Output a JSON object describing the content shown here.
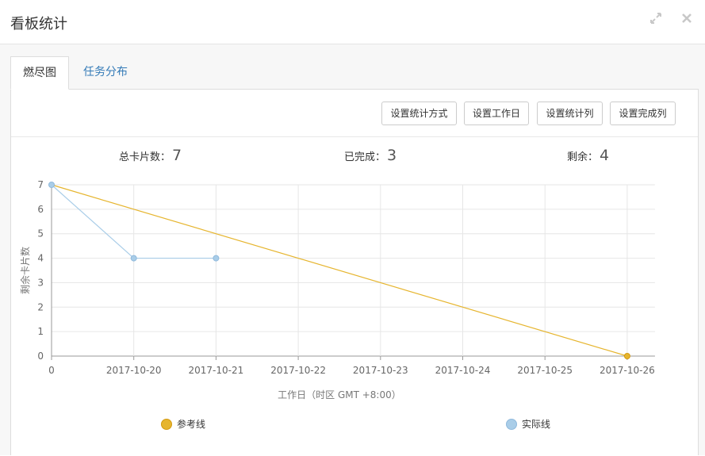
{
  "modal": {
    "title": "看板统计",
    "expand_icon": "expand-icon",
    "close_icon": "close-icon"
  },
  "tabs": [
    {
      "label": "燃尽图",
      "active": true
    },
    {
      "label": "任务分布",
      "active": false
    }
  ],
  "toolbar": {
    "buttons": [
      "设置统计方式",
      "设置工作日",
      "设置统计列",
      "设置完成列"
    ]
  },
  "stats": {
    "total_label": "总卡片数：",
    "total_value": "7",
    "done_label": "已完成：",
    "done_value": "3",
    "remain_label": "剩余：",
    "remain_value": "4"
  },
  "chart_data": {
    "type": "line",
    "x_categories": [
      "0",
      "2017-10-20",
      "2017-10-21",
      "2017-10-22",
      "2017-10-23",
      "2017-10-24",
      "2017-10-25",
      "2017-10-26"
    ],
    "ylim": [
      0,
      7
    ],
    "yticks": [
      0,
      1,
      2,
      3,
      4,
      5,
      6,
      7
    ],
    "xlabel": "工作日（时区 GMT +8:00）",
    "ylabel": "剩余卡片数",
    "grid": true,
    "legend_position": "bottom",
    "series": [
      {
        "name": "参考线",
        "color": "#e6b52e",
        "points": [
          [
            0,
            7
          ],
          [
            7,
            0
          ]
        ],
        "marker_indices": [
          1
        ]
      },
      {
        "name": "实际线",
        "color": "#a9cde8",
        "points": [
          [
            0,
            7
          ],
          [
            1,
            4
          ],
          [
            2,
            4
          ]
        ],
        "marker_indices": [
          0,
          1,
          2
        ]
      }
    ]
  }
}
